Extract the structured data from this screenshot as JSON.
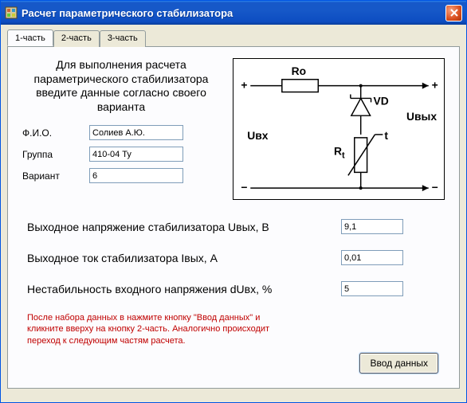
{
  "window": {
    "title": "Расчет параметрического стабилизатора"
  },
  "tabs": [
    {
      "label": "1-часть",
      "active": true
    },
    {
      "label": "2-часть",
      "active": false
    },
    {
      "label": "3-часть",
      "active": false
    }
  ],
  "instruction": "Для выполнения расчета параметрического стабилизатора введите данные согласно своего варианта",
  "info": {
    "fio_label": "Ф.И.О.",
    "fio_value": "Солиев А.Ю.",
    "group_label": "Группа",
    "group_value": "410-04 Ту",
    "variant_label": "Вариант",
    "variant_value": "6"
  },
  "schematic": {
    "Ro": "Ro",
    "VD": "VD",
    "Uin": "Uвх",
    "Uout": "Uвых",
    "Rt": "R",
    "Rt_sub": "t",
    "t": "t",
    "plus": "+",
    "minus": "−"
  },
  "params": {
    "uout_label": "Выходное напряжение стабилизатора Uвых,  В",
    "uout_value": "9,1",
    "iout_label": "Выходное ток стабилизатора Iвых,  А",
    "iout_value": "0,01",
    "duin_label": "Нестабильность входного напряжения dUвх, %",
    "duin_value": "5"
  },
  "hint": "После набора данных в нажмите кнопку \"Ввод данных\" и кликните вверху на кнопку 2-часть. Аналогично происходит переход к следующим частям расчета.",
  "submit_label": "Ввод данных"
}
